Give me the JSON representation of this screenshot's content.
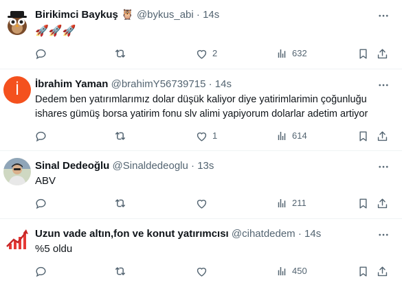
{
  "tweets": [
    {
      "name": "Birikimci Baykuş",
      "emoji": "🦉",
      "handle": "@bykus_abi",
      "dot": "·",
      "time": "14s",
      "text": "🚀🚀🚀",
      "likes": "2",
      "views": "632",
      "avatar": "owl-avatar"
    },
    {
      "name": "İbrahim Yaman",
      "handle": "@brahimY56739715",
      "dot": "·",
      "time": "14s",
      "text": "Dedem ben yatırımlarımız dolar düşük kaliyor diye yatirimlarimin çoğunluğu ishares gümüş borsa yatirim fonu slv alimi yapiyorum dolarlar adetim artiyor",
      "likes": "1",
      "views": "614",
      "avatar_letter": "İ",
      "avatar_color": "#f4511e"
    },
    {
      "name": "Sinal Dedeoğlu",
      "handle": "@Sinaldedeoglu",
      "dot": "·",
      "time": "13s",
      "text": "ABV",
      "likes": "",
      "views": "211",
      "avatar": "photo-avatar"
    },
    {
      "name": "Uzun vade altın,fon ve konut yatırımcısı",
      "handle": "@cihatdedem",
      "dot": "·",
      "time": "14s",
      "text": "%5 oldu",
      "likes": "",
      "views": "450",
      "avatar": "chart-avatar"
    }
  ],
  "colors": {
    "text": "#0f1419",
    "secondary": "#536471",
    "divider": "#eff3f4"
  },
  "icons": [
    "reply-icon",
    "retweet-icon",
    "like-icon",
    "views-icon",
    "bookmark-icon",
    "share-icon",
    "more-icon"
  ]
}
